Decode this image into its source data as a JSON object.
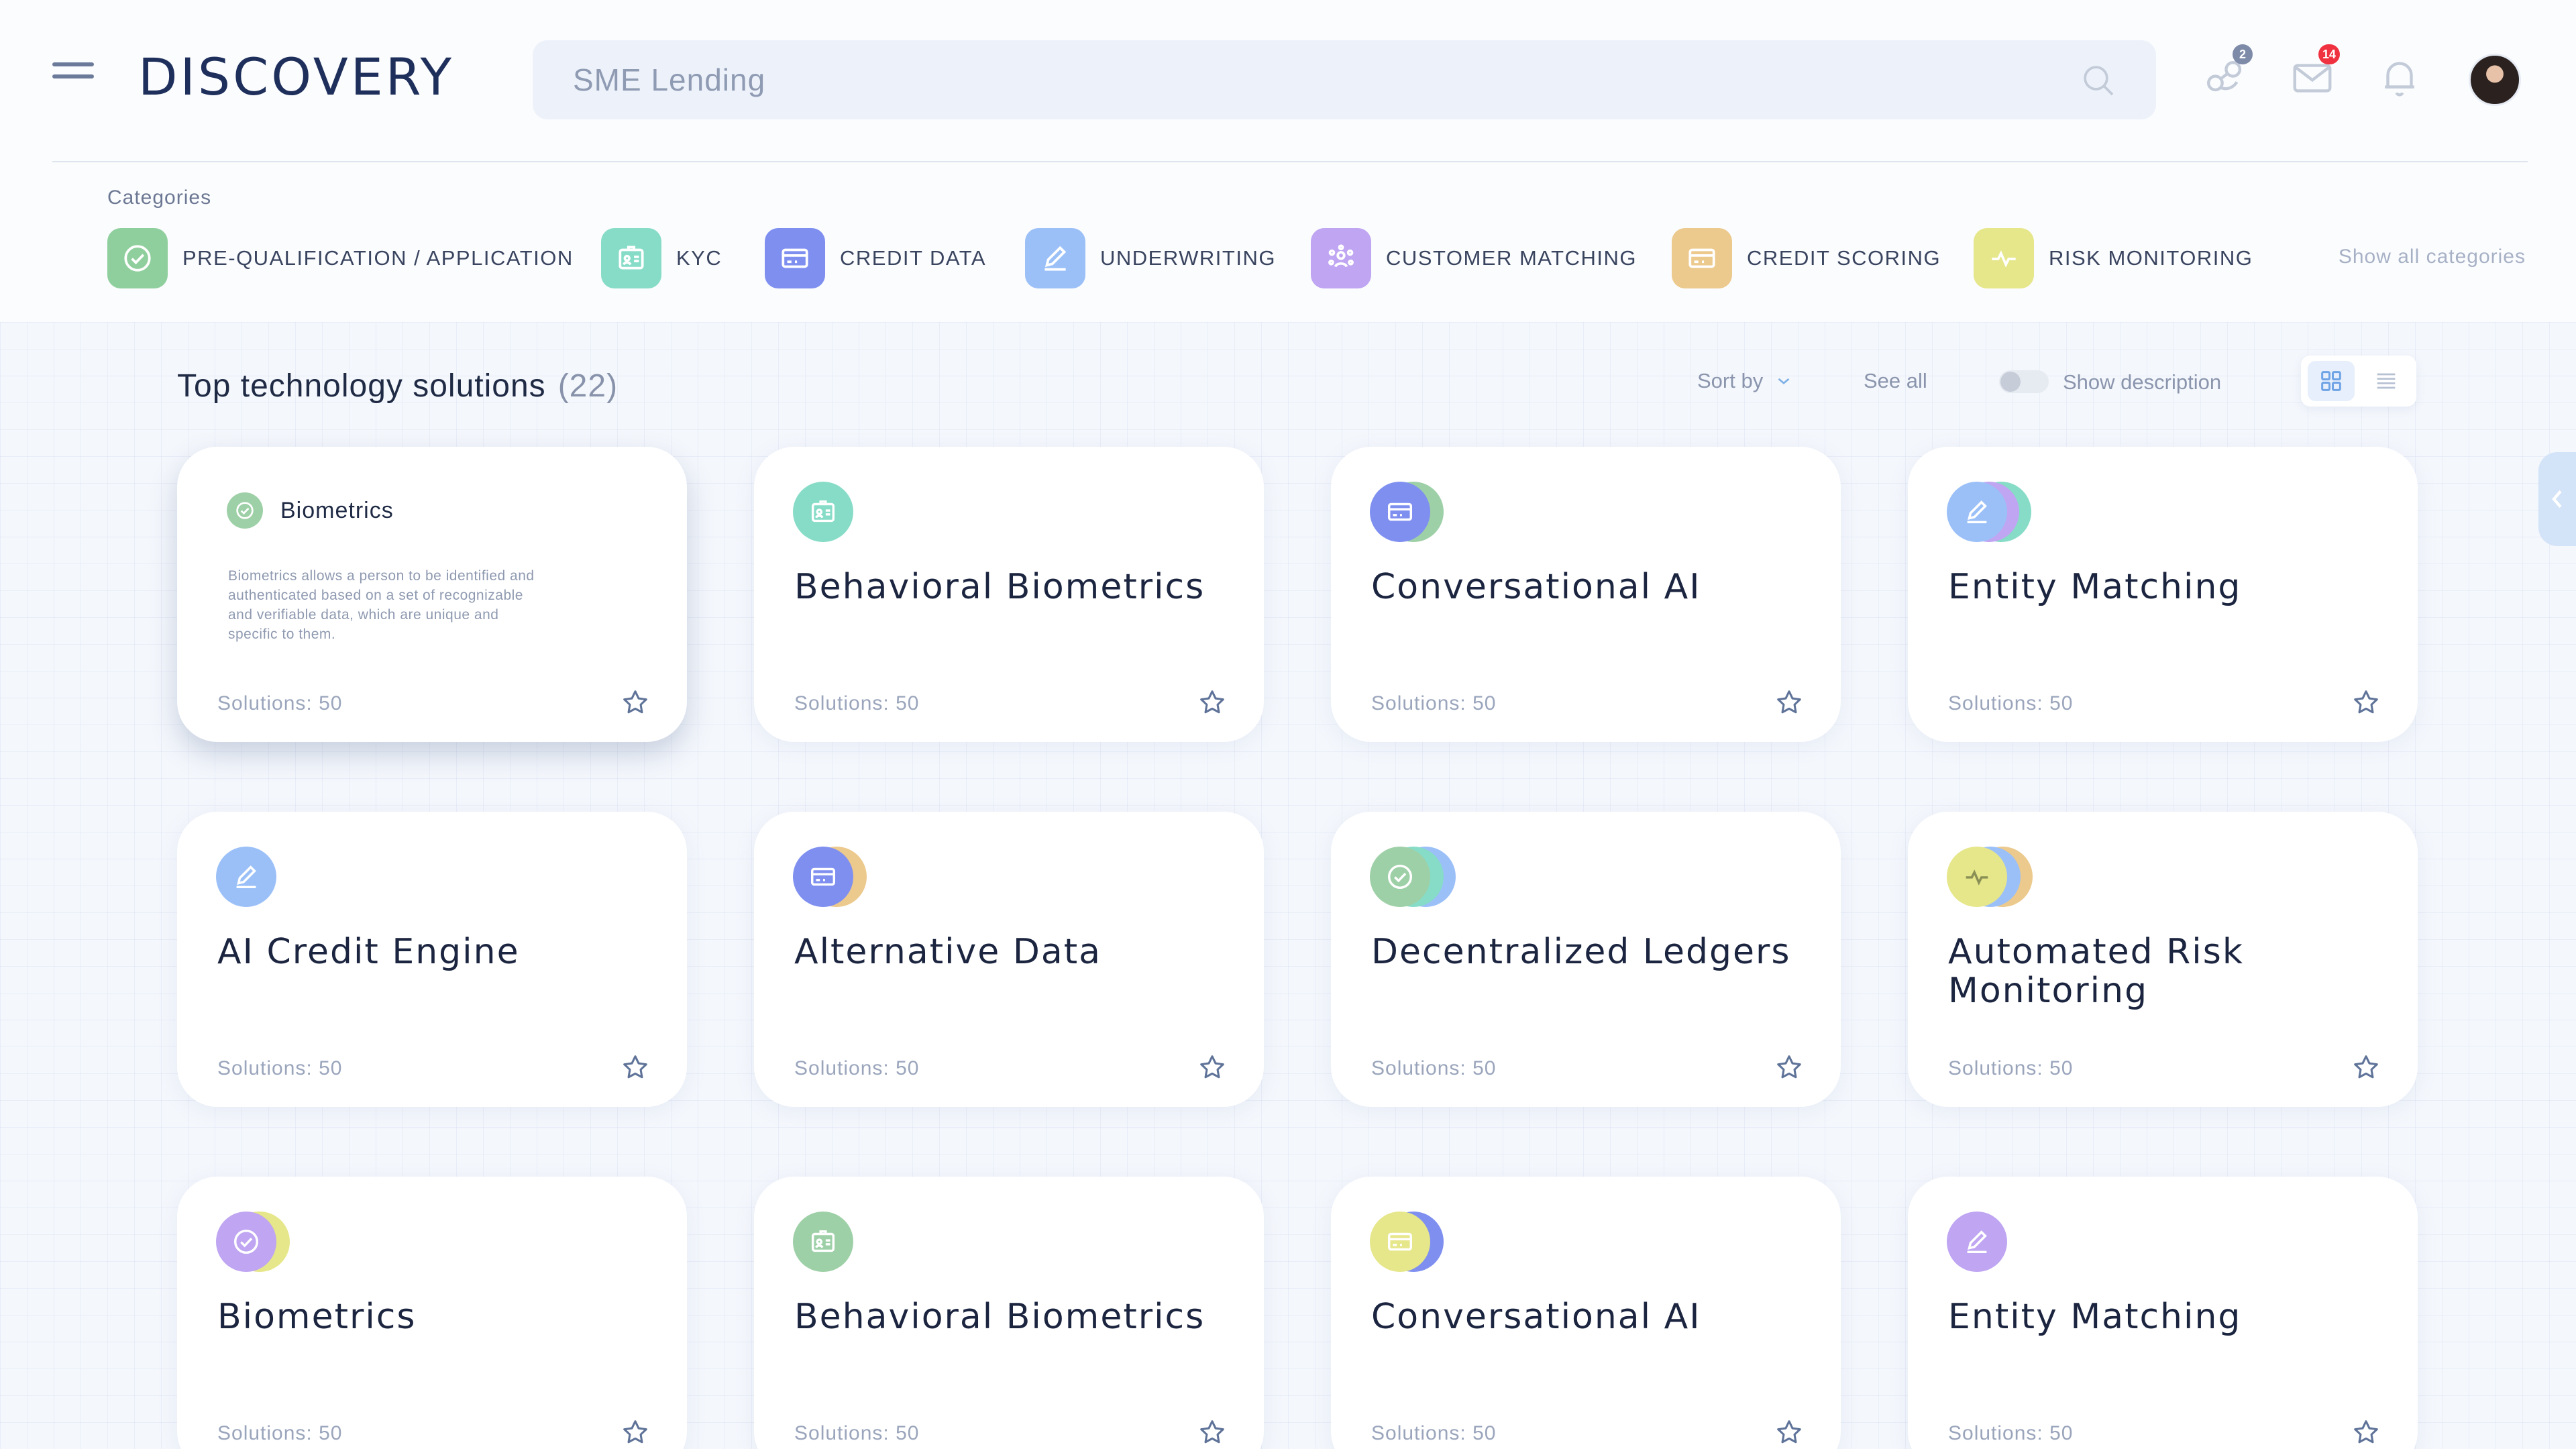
{
  "header": {
    "logo": "DISCOVERY",
    "search_value": "SME Lending",
    "connections_badge": "2",
    "messages_badge": "14"
  },
  "categories": {
    "title": "Categories",
    "show_all": "Show all categories",
    "items": [
      {
        "label": "PRE-QUALIFICATION / APPLICATION",
        "color": "#8fcf9d",
        "icon": "check-circle-icon"
      },
      {
        "label": "KYC",
        "color": "#86dcc7",
        "icon": "id-card-icon"
      },
      {
        "label": "CREDIT DATA",
        "color": "#7f8ff0",
        "icon": "credit-card-icon"
      },
      {
        "label": "UNDERWRITING",
        "color": "#9bc0f8",
        "icon": "pen-icon"
      },
      {
        "label": "CUSTOMER MATCHING",
        "color": "#bfa5f2",
        "icon": "people-icon"
      },
      {
        "label": "CREDIT SCORING",
        "color": "#ecc98c",
        "icon": "credit-card-icon"
      },
      {
        "label": "RISK MONITORING",
        "color": "#e6e68a",
        "icon": "pulse-icon"
      }
    ]
  },
  "section": {
    "title": "Top technology solutions",
    "count": "(22)",
    "sort_label": "Sort by",
    "see_all": "See all",
    "show_description": "Show description"
  },
  "cards": [
    {
      "title": "Biometrics",
      "description": "Biometrics allows a person to be identified and authenticated based on a set of recognizable and verifiable data, which are unique and specific to them.",
      "solutions": "Solutions: 50"
    },
    {
      "title": "Behavioral Biometrics",
      "solutions": "Solutions: 50"
    },
    {
      "title": "Conversational AI",
      "solutions": "Solutions: 50"
    },
    {
      "title": "Entity Matching",
      "solutions": "Solutions: 50"
    },
    {
      "title": "AI Credit Engine",
      "solutions": "Solutions: 50"
    },
    {
      "title": "Alternative Data",
      "solutions": "Solutions: 50"
    },
    {
      "title": "Decentralized Ledgers",
      "solutions": "Solutions: 50"
    },
    {
      "title": "Automated Risk Monitoring",
      "solutions": "Solutions: 50"
    },
    {
      "title": "Biometrics",
      "solutions": "Solutions: 50"
    },
    {
      "title": "Behavioral Biometrics",
      "solutions": "Solutions: 50"
    },
    {
      "title": "Conversational AI",
      "solutions": "Solutions: 50"
    },
    {
      "title": "Entity Matching",
      "solutions": "Solutions: 50"
    }
  ]
}
